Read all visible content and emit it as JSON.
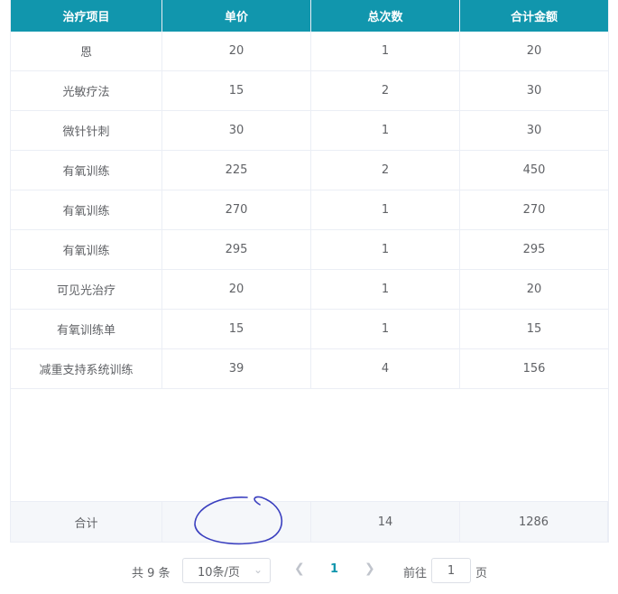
{
  "table": {
    "headers": [
      "治疗项目",
      "单价",
      "总次数",
      "合计金额"
    ],
    "rows": [
      [
        "恩",
        "20",
        "1",
        "20"
      ],
      [
        "光敏疗法",
        "15",
        "2",
        "30"
      ],
      [
        "微针针刺",
        "30",
        "1",
        "30"
      ],
      [
        "有氧训练",
        "225",
        "2",
        "450"
      ],
      [
        "有氧训练",
        "270",
        "1",
        "270"
      ],
      [
        "有氧训练",
        "295",
        "1",
        "295"
      ],
      [
        "可见光治疗",
        "20",
        "1",
        "20"
      ],
      [
        "有氧训练单",
        "15",
        "1",
        "15"
      ],
      [
        "减重支持系统训练",
        "39",
        "4",
        "156"
      ]
    ],
    "footer": [
      "合计",
      "",
      "14",
      "1286"
    ]
  },
  "pagination": {
    "total_label": "共 9 条",
    "page_size_label": "10条/页",
    "current_page": "1",
    "goto_prefix": "前往",
    "goto_value": "1",
    "goto_suffix": "页"
  },
  "colors": {
    "header_bg": "#1196ad",
    "accent": "#1196ad",
    "footer_bg": "#f5f7fa",
    "scribble": "#3a3fbf"
  },
  "icons": {
    "prev": "chevron-left-icon",
    "next": "chevron-right-icon",
    "dropdown": "chevron-down-icon"
  }
}
